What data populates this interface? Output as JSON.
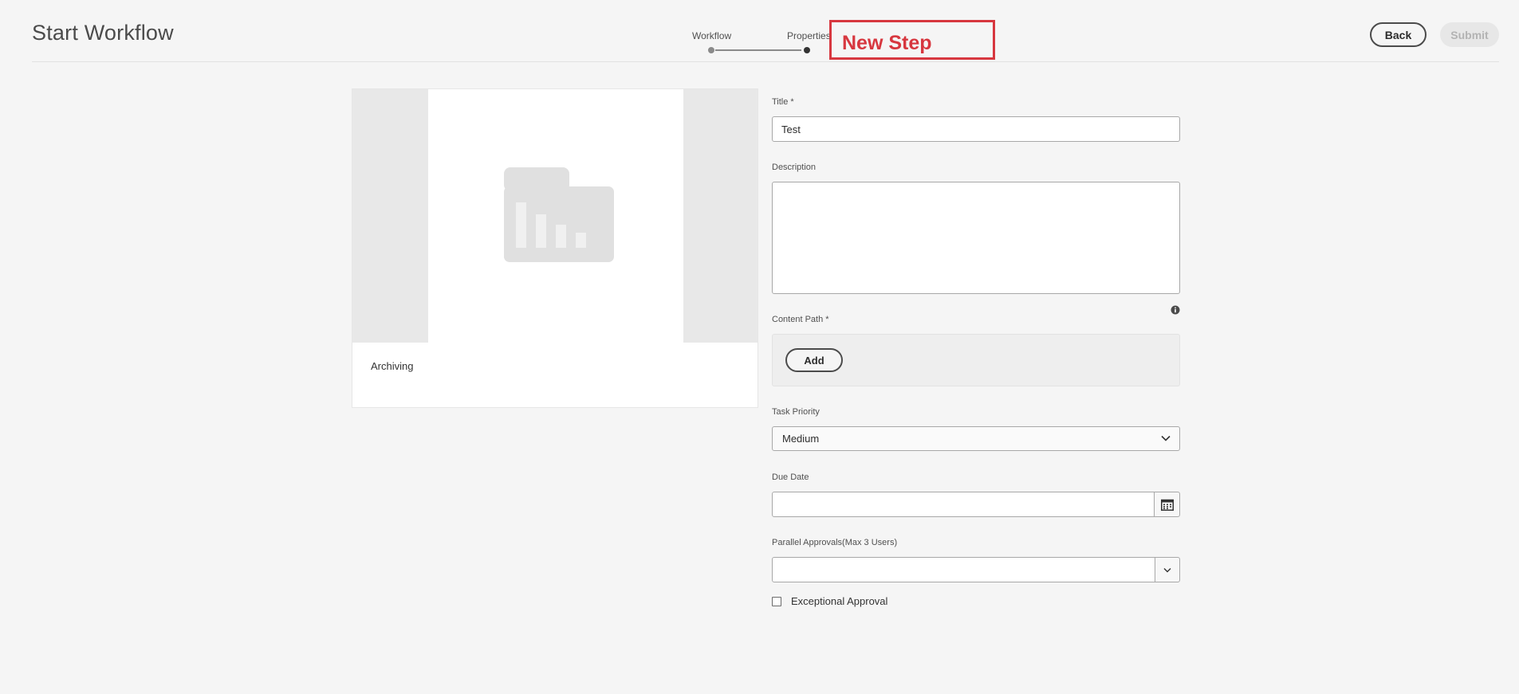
{
  "header": {
    "title": "Start Workflow",
    "steps": [
      {
        "label": "Workflow"
      },
      {
        "label": "Properties"
      }
    ],
    "annotation": "New Step",
    "back_label": "Back",
    "submit_label": "Submit"
  },
  "card": {
    "title": "Archiving",
    "thumbnail_icon": "folder-chart-icon"
  },
  "form": {
    "title": {
      "label": "Title *",
      "value": "Test"
    },
    "description": {
      "label": "Description",
      "value": ""
    },
    "content_path": {
      "label": "Content Path *",
      "add_label": "Add",
      "info_icon": "info-icon"
    },
    "task_priority": {
      "label": "Task Priority",
      "value": "Medium"
    },
    "due_date": {
      "label": "Due Date",
      "value": "",
      "icon": "calendar-icon"
    },
    "parallel_approvals": {
      "label": "Parallel Approvals(Max 3 Users)",
      "value": ""
    },
    "exceptional_approval": {
      "label": "Exceptional Approval",
      "checked": false
    }
  },
  "colors": {
    "annotation": "#d7373f",
    "background": "#f5f5f5"
  }
}
